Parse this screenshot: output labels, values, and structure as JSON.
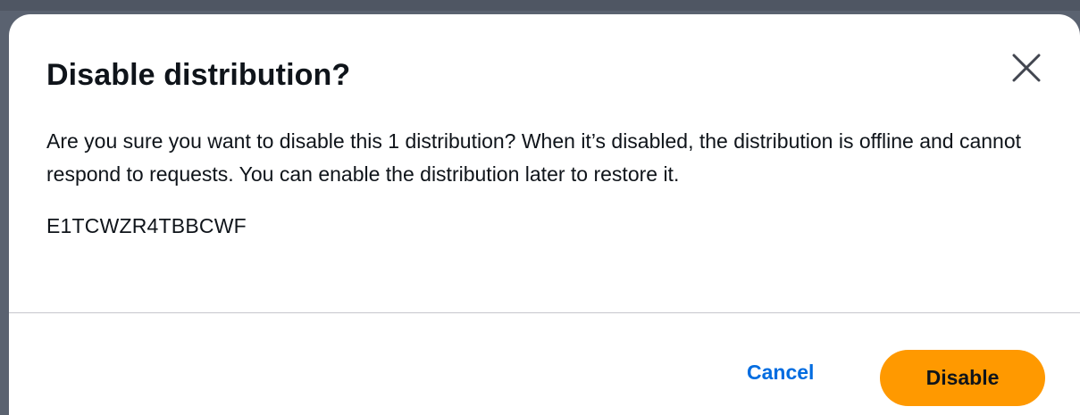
{
  "modal": {
    "title": "Disable distribution?",
    "close_icon": "close-icon",
    "message": "Are you sure you want to disable this 1 distribution? When it’s disabled, the distribution is offline and cannot respond to requests. You can enable the distribution later to restore it.",
    "distribution_id": "E1TCWZR4TBBCWF"
  },
  "footer": {
    "cancel_label": "Cancel",
    "disable_label": "Disable"
  },
  "colors": {
    "primary_button": "#ff9900",
    "link_button": "#006ce0",
    "text": "#0f141a"
  }
}
